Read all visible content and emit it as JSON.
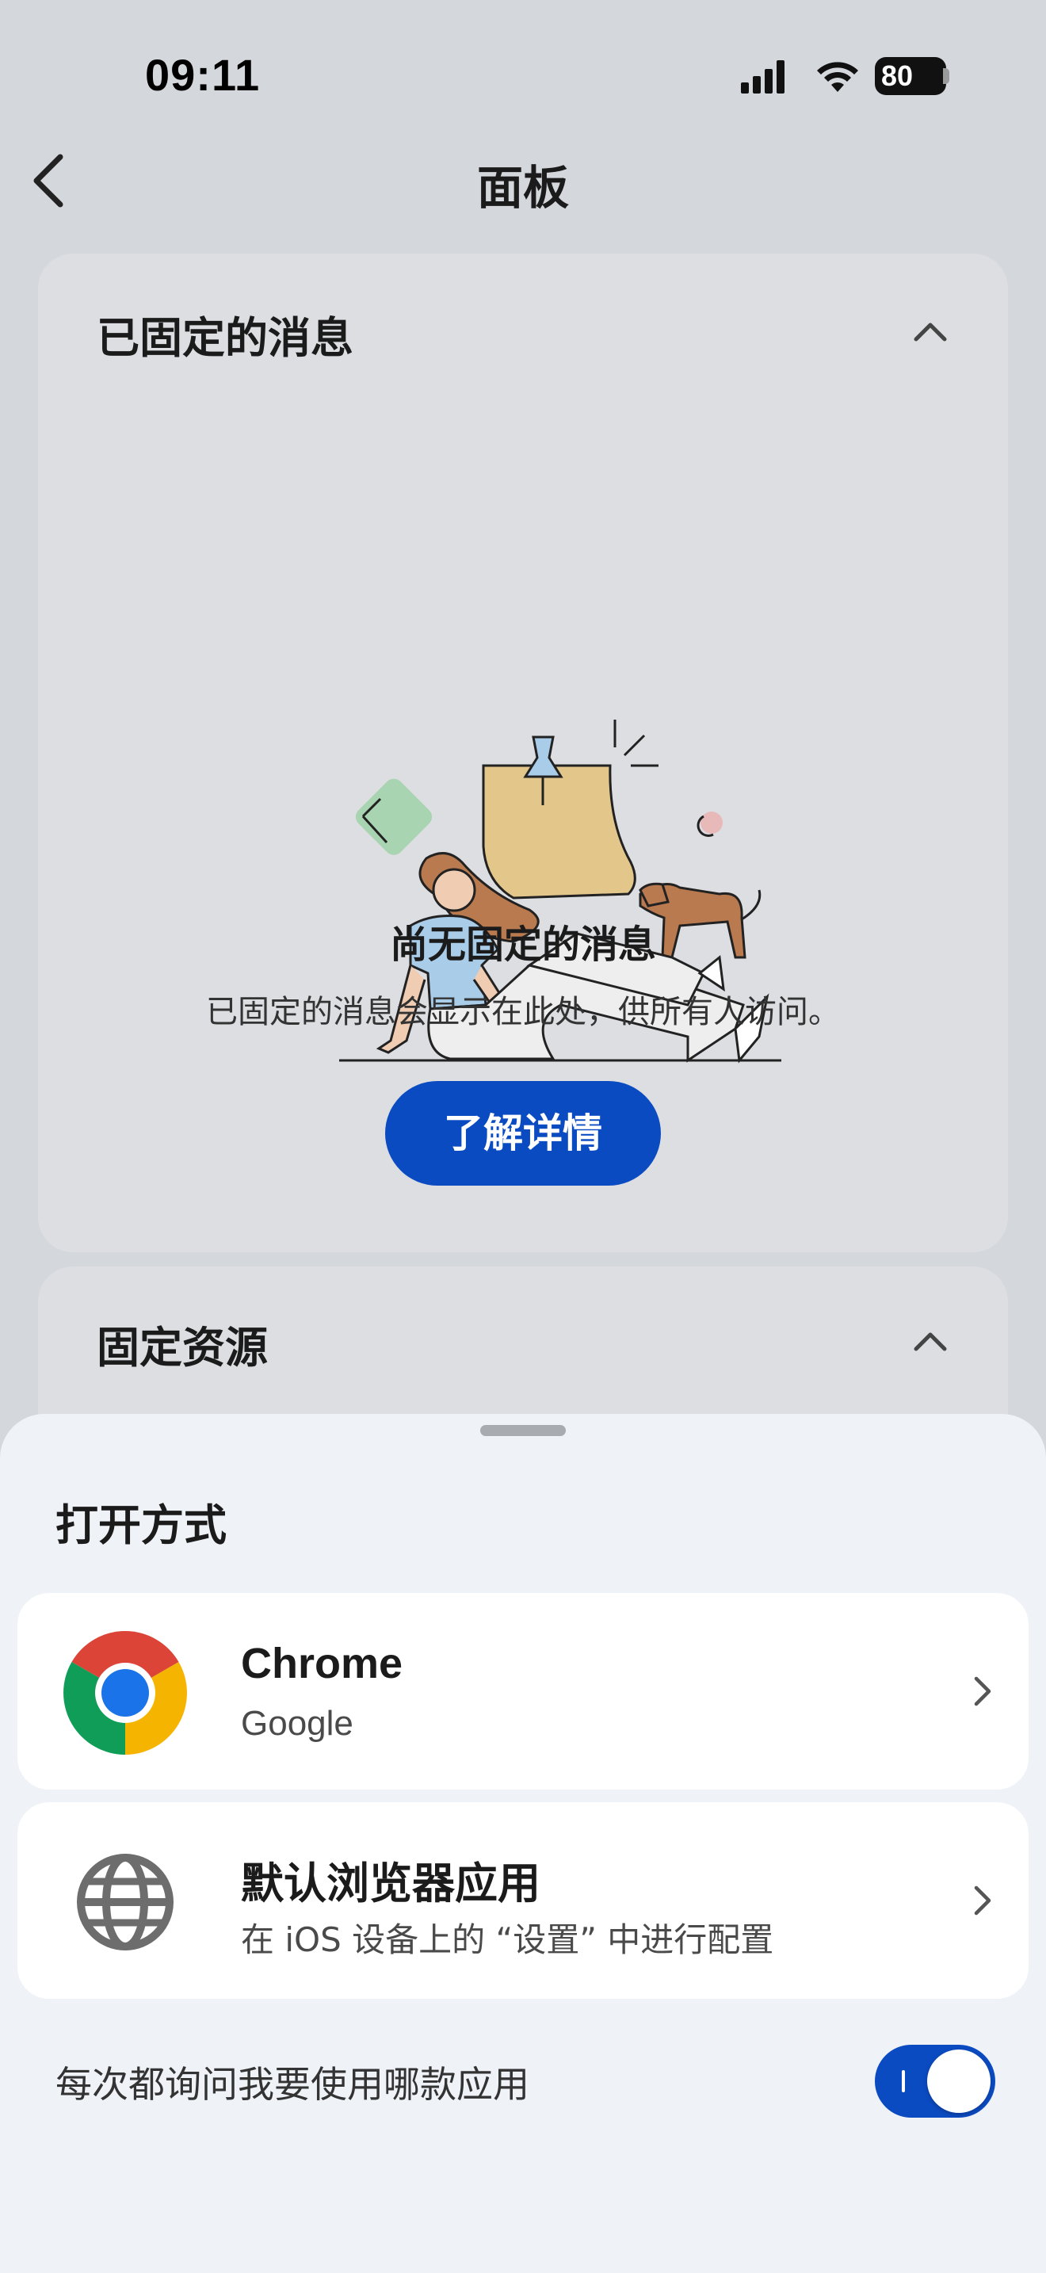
{
  "status_bar": {
    "time": "09:11",
    "battery": "80"
  },
  "header": {
    "title": "面板"
  },
  "pinned_messages": {
    "title": "已固定的消息",
    "empty_title": "尚无固定的消息",
    "empty_description": "已固定的消息会显示在此处，供所有人访问。",
    "learn_more_label": "了解详情"
  },
  "pinned_resources": {
    "title": "固定资源"
  },
  "open_with_sheet": {
    "title": "打开方式",
    "options": [
      {
        "name": "Chrome",
        "subtitle": "Google",
        "icon": "chrome-icon"
      },
      {
        "name": "默认浏览器应用",
        "subtitle": "在 iOS 设备上的 “设置” 中进行配置",
        "icon": "globe-icon"
      }
    ],
    "ask_every_time_label": "每次都询问我要使用哪款应用",
    "ask_every_time_enabled": true
  },
  "colors": {
    "accent": "#0b4bc2",
    "background": "#d4d7dc",
    "sheet": "#eff2f7"
  }
}
